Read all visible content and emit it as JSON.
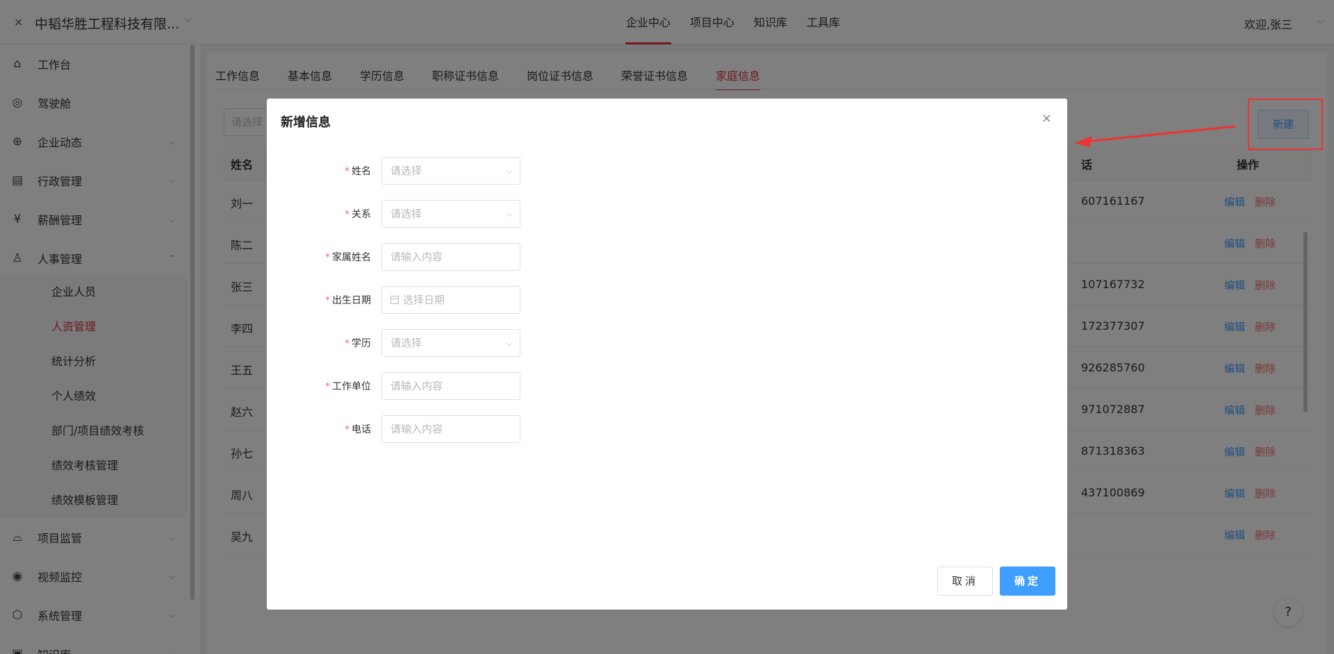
{
  "topbar": {
    "close": "×",
    "company": "中韬华胜工程科技有限...",
    "company_caret": "⌵",
    "nav": [
      "企业中心",
      "项目中心",
      "知识库",
      "工具库"
    ],
    "active_nav": "企业中心",
    "welcome": "欢迎,张三",
    "welcome_caret": "⌵"
  },
  "sidebar": {
    "items": [
      {
        "label": "工作台",
        "icon": "home-icon",
        "glyph": "⌂",
        "caret": ""
      },
      {
        "label": "驾驶舱",
        "icon": "steering-wheel-icon",
        "glyph": "◎",
        "caret": ""
      },
      {
        "label": "企业动态",
        "icon": "globe-icon",
        "glyph": "⊕",
        "caret": "⌵"
      },
      {
        "label": "行政管理",
        "icon": "document-gear-icon",
        "glyph": "▤",
        "caret": "⌵"
      },
      {
        "label": "薪酬管理",
        "icon": "yuan-coin-icon",
        "glyph": "¥",
        "caret": "⌵"
      },
      {
        "label": "人事管理",
        "icon": "user-icon",
        "glyph": "♙",
        "caret": "⌃"
      }
    ],
    "sub_items": [
      "企业人员",
      "人资管理",
      "统计分析",
      "个人绩效",
      "部门/项目绩效考核",
      "绩效考核管理",
      "绩效模板管理"
    ],
    "active_sub": "人资管理",
    "bottom_items": [
      {
        "label": "项目监管",
        "icon": "helmet-icon",
        "glyph": "⌓",
        "caret": "⌵"
      },
      {
        "label": "视频监控",
        "icon": "camera-icon",
        "glyph": "◉",
        "caret": "⌵"
      },
      {
        "label": "系统管理",
        "icon": "settings-icon",
        "glyph": "⬡",
        "caret": "⌵"
      },
      {
        "label": "知识库",
        "icon": "book-icon",
        "glyph": "▣",
        "caret": "⌵"
      }
    ]
  },
  "tabs": [
    "工作信息",
    "基本信息",
    "学历信息",
    "职称证书信息",
    "岗位证书信息",
    "荣誉证书信息",
    "家庭信息"
  ],
  "active_tab": "家庭信息",
  "filter": {
    "placeholder": "请选择"
  },
  "new_button": "新建",
  "table": {
    "headers": {
      "name": "姓名",
      "phone": "话",
      "ops": "操作"
    },
    "rows": [
      {
        "name": "刘一",
        "phone": "607161167"
      },
      {
        "name": "陈二",
        "phone": ""
      },
      {
        "name": "张三",
        "phone": "107167732"
      },
      {
        "name": "李四",
        "phone": "172377307"
      },
      {
        "name": "王五",
        "phone": "926285760"
      },
      {
        "name": "赵六",
        "phone": "971072887"
      },
      {
        "name": "孙七",
        "phone": "871318363"
      },
      {
        "name": "周八",
        "phone": "437100869"
      },
      {
        "name": "吴九",
        "phone": ""
      }
    ],
    "edit_label": "编辑",
    "delete_label": "删除"
  },
  "help": "?",
  "modal": {
    "title": "新增信息",
    "close": "×",
    "fields": [
      {
        "label": "姓名",
        "placeholder": "请选择",
        "type": "select"
      },
      {
        "label": "关系",
        "placeholder": "请选择",
        "type": "select"
      },
      {
        "label": "家属姓名",
        "placeholder": "请输入内容",
        "type": "input"
      },
      {
        "label": "出生日期",
        "placeholder": "选择日期",
        "type": "date"
      },
      {
        "label": "学历",
        "placeholder": "请选择",
        "type": "select"
      },
      {
        "label": "工作单位",
        "placeholder": "请输入内容",
        "type": "input"
      },
      {
        "label": "电话",
        "placeholder": "请输入内容",
        "type": "input"
      }
    ],
    "required_mark": "*",
    "cancel": "取消",
    "confirm": "确定"
  },
  "colors": {
    "accent": "#d9363e",
    "primary": "#409eff",
    "danger": "#f56c6c",
    "annotation": "#ee3333"
  }
}
